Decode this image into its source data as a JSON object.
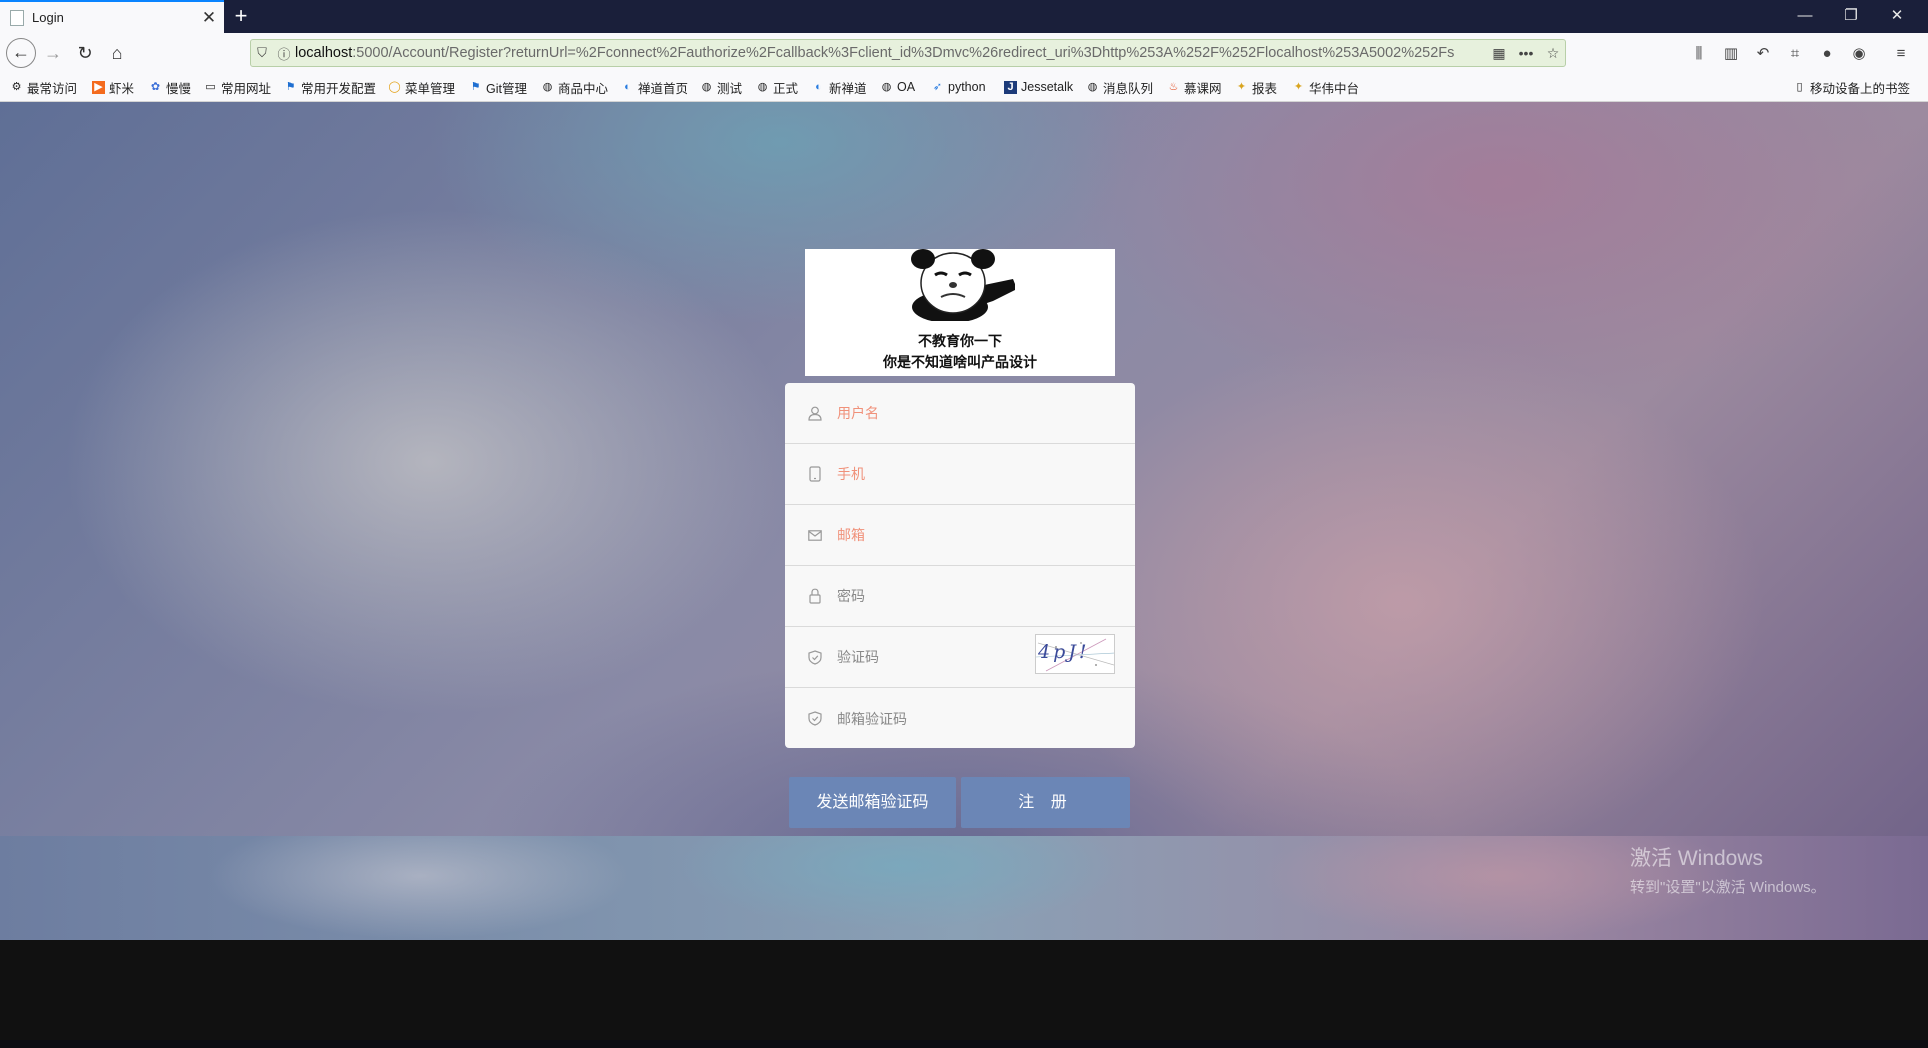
{
  "browser": {
    "tab_title": "Login",
    "url_host": "localhost",
    "url_rest": ":5000/Account/Register?returnUrl=%2Fconnect%2Fauthorize%2Fcallback%3Fclient_id%3Dmvc%26redirect_uri%3Dhttp%253A%252F%252Flocalhost%253A5002%252Fs"
  },
  "bookmarks": [
    {
      "label": "最常访问",
      "icon": "gear-icon"
    },
    {
      "label": "虾米",
      "icon": "play-icon"
    },
    {
      "label": "慢慢",
      "icon": "flower-icon"
    },
    {
      "label": "常用网址",
      "icon": "folder-icon"
    },
    {
      "label": "常用开发配置",
      "icon": "flag-icon"
    },
    {
      "label": "菜单管理",
      "icon": "circle-icon"
    },
    {
      "label": "Git管理",
      "icon": "flag-icon"
    },
    {
      "label": "商品中心",
      "icon": "globe-icon"
    },
    {
      "label": "禅道首页",
      "icon": "zentao-icon"
    },
    {
      "label": "测试",
      "icon": "globe-icon"
    },
    {
      "label": "正式",
      "icon": "globe-icon"
    },
    {
      "label": "新禅道",
      "icon": "zentao-icon"
    },
    {
      "label": "OA",
      "icon": "globe-icon"
    },
    {
      "label": "python",
      "icon": "rocket-icon"
    },
    {
      "label": "Jessetalk",
      "icon": "j-icon"
    },
    {
      "label": "消息队列",
      "icon": "globe-icon"
    },
    {
      "label": "慕课网",
      "icon": "fire-icon"
    },
    {
      "label": "报表",
      "icon": "star-icon"
    },
    {
      "label": "华伟中台",
      "icon": "star-icon"
    }
  ],
  "mobile_bookmarks": "移动设备上的书签",
  "meme": {
    "line1": "不教育你一下",
    "line2": "你是不知道啥叫产品设计"
  },
  "form": {
    "username_placeholder": "用户名",
    "phone_placeholder": "手机",
    "email_placeholder": "邮箱",
    "password_placeholder": "密码",
    "captcha_placeholder": "验证码",
    "captcha_text": "4pJ!",
    "email_code_placeholder": "邮箱验证码"
  },
  "buttons": {
    "send_code": "发送邮箱验证码",
    "register": "注 册"
  },
  "watermark": {
    "title": "激活 Windows",
    "subtitle": "转到\"设置\"以激活 Windows。"
  },
  "colors": {
    "button": "#6b86b6",
    "placeholder_pink": "#f0917a",
    "tab_accent": "#0a84ff"
  }
}
